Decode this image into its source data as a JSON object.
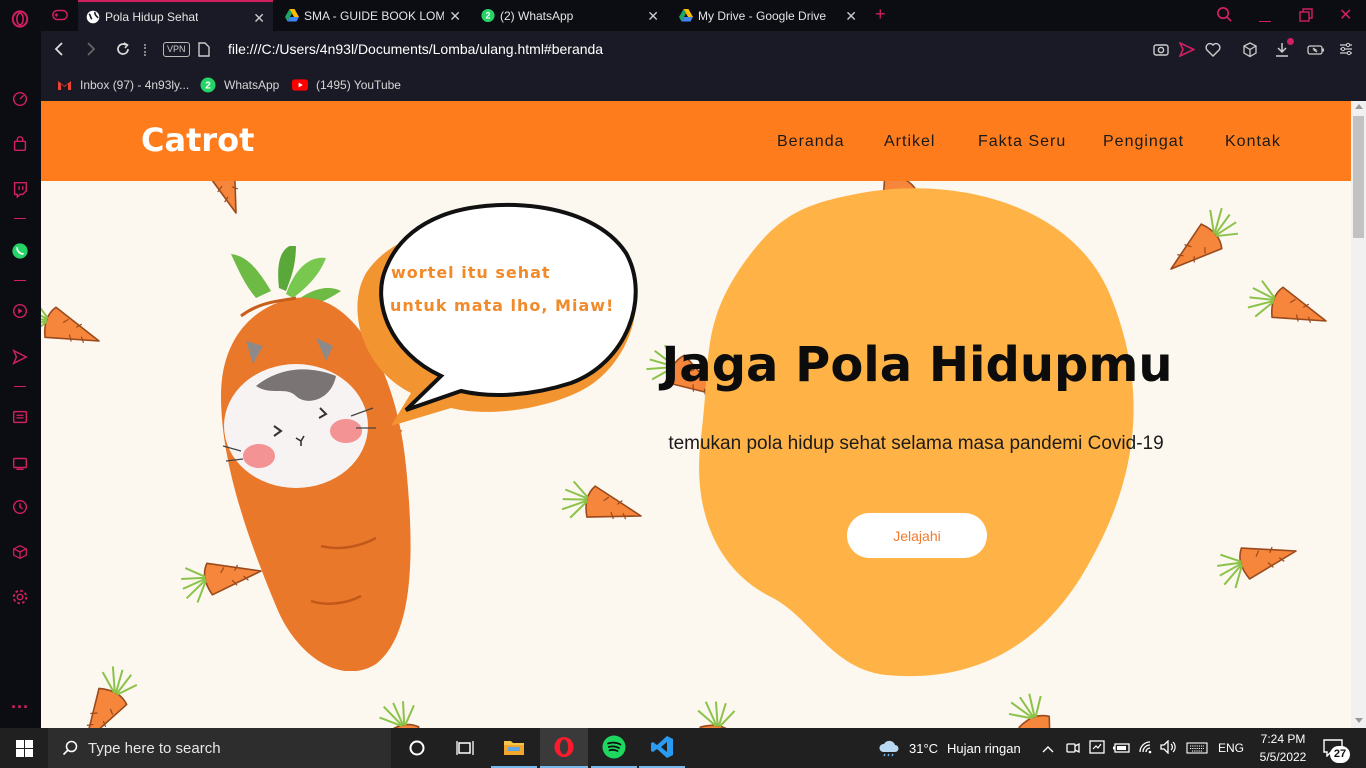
{
  "browser": {
    "tabs": [
      {
        "title": "Pola Hidup Sehat",
        "active": true,
        "icon": "globe-icon"
      },
      {
        "title": "SMA - GUIDE BOOK LOMBA",
        "active": false,
        "icon": "google-drive-icon"
      },
      {
        "title": "(2) WhatsApp",
        "active": false,
        "icon": "whatsapp-icon"
      },
      {
        "title": "My Drive - Google Drive",
        "active": false,
        "icon": "google-drive-icon"
      }
    ],
    "url": "file:///C:/Users/4n93l/Documents/Lomba/ulang.html#beranda",
    "vpn_label": "VPN",
    "bookmarks": [
      {
        "label": "Inbox (97) - 4n93ly...",
        "icon": "gmail-icon"
      },
      {
        "label": "WhatsApp",
        "icon": "whatsapp-icon"
      },
      {
        "label": "(1495) YouTube",
        "icon": "youtube-icon"
      }
    ],
    "whatsapp_badge": "2",
    "accent": "#d0205f"
  },
  "site": {
    "logo": "Catrot",
    "nav": [
      "Beranda",
      "Artikel",
      "Fakta Seru",
      "Pengingat",
      "Kontak"
    ],
    "hero_title": "Jaga Pola Hidupmu",
    "hero_subtitle": "temukan pola hidup sehat selama masa pandemi Covid-19",
    "hero_button": "Jelajahi",
    "bubble_line1": "wortel itu sehat",
    "bubble_line2": "untuk mata lho, Miaw!",
    "nav_color": "#fe7c1b",
    "blob_color": "#ffb347"
  },
  "taskbar": {
    "search_placeholder": "Type here to search",
    "weather_temp": "31°C",
    "weather_desc": "Hujan ringan",
    "language": "ENG",
    "time": "7:24 PM",
    "date": "5/5/2022",
    "notification_count": "27"
  }
}
